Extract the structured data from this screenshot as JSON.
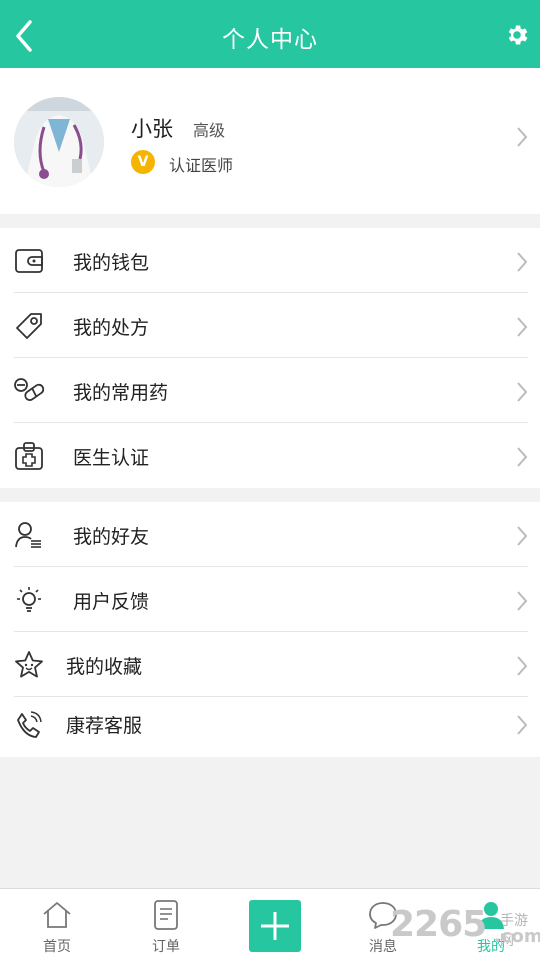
{
  "header": {
    "title": "个人中心",
    "back_icon": "chevron-left-icon",
    "settings_icon": "gear-icon",
    "bg_color": "#26c6a0"
  },
  "profile": {
    "name": "小张",
    "level": "高级",
    "badge_letter": "V",
    "certification": "认证医师",
    "badge_color": "#f5b400"
  },
  "menu_group_1": [
    {
      "label": "我的钱包",
      "icon": "wallet-icon"
    },
    {
      "label": "我的处方",
      "icon": "tag-icon"
    },
    {
      "label": "我的常用药",
      "icon": "pill-icon"
    },
    {
      "label": "医生认证",
      "icon": "doctor-badge-icon"
    }
  ],
  "menu_group_2": [
    {
      "label": "我的好友",
      "icon": "friends-icon"
    },
    {
      "label": "用户反馈",
      "icon": "bulb-icon"
    },
    {
      "label": "我的收藏",
      "icon": "star-icon"
    },
    {
      "label": "康荐客服",
      "icon": "phone-icon"
    }
  ],
  "tabbar": {
    "tabs": [
      {
        "label": "首页",
        "icon": "home-icon"
      },
      {
        "label": "订单",
        "icon": "order-icon"
      },
      {
        "label": "",
        "icon": "plus-icon"
      },
      {
        "label": "消息",
        "icon": "message-icon"
      },
      {
        "label": "我的",
        "icon": "user-icon",
        "active": true
      }
    ]
  },
  "watermark": {
    "number": "2265",
    "text": "手游网",
    "domain": ".com"
  }
}
